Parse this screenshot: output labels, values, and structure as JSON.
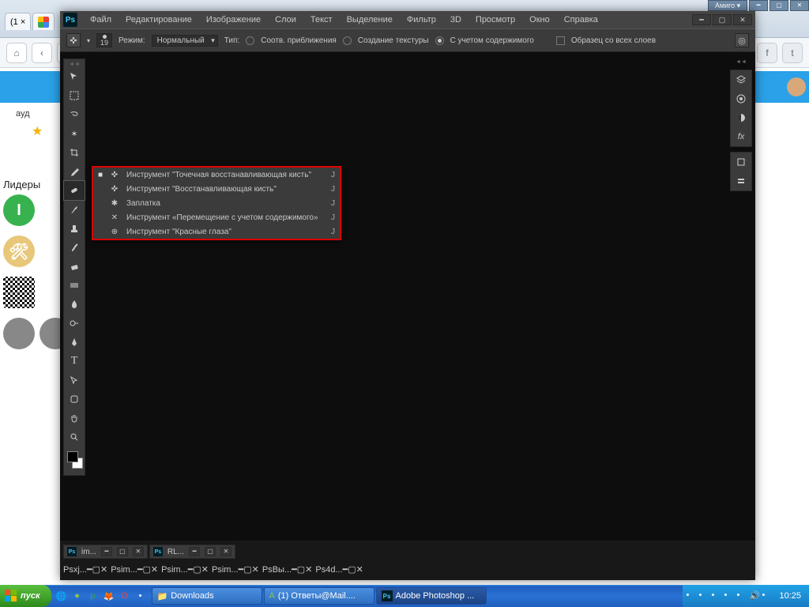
{
  "browser": {
    "window_buttons": {
      "label": "Амиго ▾"
    },
    "tabs": [
      {
        "label": "(1   ×"
      },
      {
        "label": "",
        "icon": "google"
      }
    ],
    "side_label": "ауд",
    "leaders_label": "Лидеры"
  },
  "photoshop": {
    "menu": [
      "Файл",
      "Редактирование",
      "Изображение",
      "Слои",
      "Текст",
      "Выделение",
      "Фильтр",
      "3D",
      "Просмотр",
      "Окно",
      "Справка"
    ],
    "options": {
      "mode_label": "Режим:",
      "mode_value": "Нормальный",
      "type_label": "Тип:",
      "brush_size": "19",
      "radios": [
        {
          "label": "Соотв. приближения",
          "on": false
        },
        {
          "label": "Создание текстуры",
          "on": false
        },
        {
          "label": "С учетом содержимого",
          "on": true
        }
      ],
      "sample_all": "Образец со всех слоев"
    },
    "tool_flyout": [
      {
        "marker": "■",
        "icon": "✜",
        "name": "Инструмент \"Точечная восстанавливающая кисть\"",
        "key": "J"
      },
      {
        "marker": "",
        "icon": "✜",
        "name": "Инструмент \"Восстанавливающая кисть\"",
        "key": "J"
      },
      {
        "marker": "",
        "icon": "✱",
        "name": "Заплатка",
        "key": "J"
      },
      {
        "marker": "",
        "icon": "✕",
        "name": "Инструмент «Перемещение с учетом содержимого»",
        "key": "J"
      },
      {
        "marker": "",
        "icon": "⊕",
        "name": "Инструмент \"Красные глаза\"",
        "key": "J"
      }
    ],
    "doc_tabs_top": [
      {
        "label": "im..."
      },
      {
        "label": "RL..."
      }
    ],
    "doc_tabs_bottom": [
      {
        "label": "xj..."
      },
      {
        "label": "im..."
      },
      {
        "label": "im..."
      },
      {
        "label": "im..."
      },
      {
        "label": "Вы..."
      },
      {
        "label": "4d..."
      }
    ]
  },
  "taskbar": {
    "start": "пуск",
    "tasks": [
      {
        "label": "Downloads",
        "icon": "folder"
      },
      {
        "label": "(1) Ответы@Mail....",
        "icon": "amigo"
      },
      {
        "label": "Adobe Photoshop ...",
        "icon": "ps",
        "active": true
      }
    ],
    "clock": "10:25"
  }
}
